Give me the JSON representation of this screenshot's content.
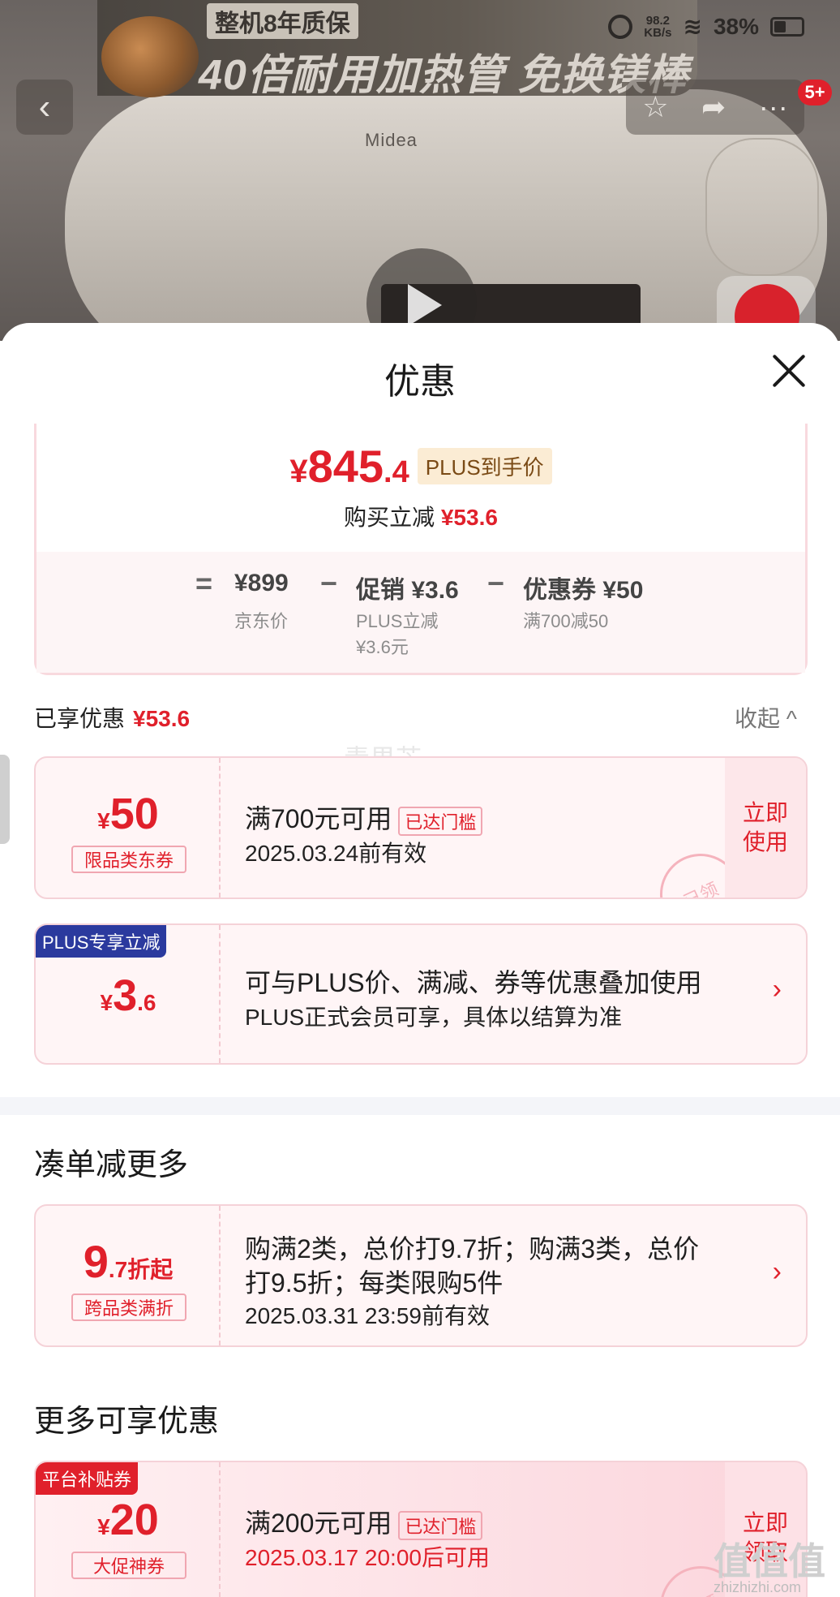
{
  "status_bar": {
    "speed_value": "98.2",
    "speed_unit": "KB/s",
    "battery": "38%"
  },
  "hero": {
    "banner_top": "整机8年质保",
    "banner_main": "40倍耐用加热管 免换镁棒",
    "brand": "Midea"
  },
  "nav": {
    "back_icon": "‹",
    "star_icon": "☆",
    "share_icon": "➦",
    "more_icon": "···",
    "badge": "5+"
  },
  "sheet": {
    "title": "优惠",
    "price": {
      "yen": "¥",
      "integer": "845",
      "decimal": ".4",
      "tag": "PLUS到手价"
    },
    "reduction": {
      "label": "购买立减",
      "value": "¥53.6"
    },
    "breakdown": {
      "equals": "=",
      "jd_price": "¥899",
      "jd_label": "京东价",
      "minus1": "−",
      "promo": "促销 ¥3.6",
      "promo_sub1": "PLUS立减",
      "promo_sub2": "¥3.6元",
      "minus2": "−",
      "coupon": "优惠券 ¥50",
      "coupon_sub": "满700减50"
    },
    "enjoyed": {
      "label": "已享优惠",
      "value": "¥53.6",
      "collapse": "收起",
      "collapse_icon": "^"
    },
    "watermark": "青果芒"
  },
  "cards": [
    {
      "yen": "¥",
      "amount": "50",
      "pill": "限品类东券",
      "title": "满700元可用",
      "threshold": "已达门槛",
      "date": "2025.03.24前有效",
      "action_line1": "立即",
      "action_line2": "使用",
      "stamp": "已领"
    },
    {
      "corner": "PLUS专享立减",
      "yen": "¥",
      "amount": "3",
      "amount_dec": ".6",
      "title": "可与PLUS价、满减、券等优惠叠加使用",
      "sub": "PLUS正式会员可享，具体以结算为准",
      "chevron": "›"
    }
  ],
  "section_more_orders": {
    "heading": "凑单减更多",
    "card": {
      "amount": "9",
      "amount_suffix": ".7折起",
      "pill": "跨品类满折",
      "line1": "购满2类，总价打9.7折；购满3类，总价",
      "line2": "打9.5折；每类限购5件",
      "date": "2025.03.31 23:59前有效",
      "chevron": "›"
    }
  },
  "section_more_offers": {
    "heading": "更多可享优惠",
    "card": {
      "corner": "平台补贴券",
      "yen": "¥",
      "amount": "20",
      "pill": "大促神券",
      "title": "满200元可用",
      "threshold": "已达门槛",
      "date": "2025.03.17 20:00后可用",
      "action_line1": "立即",
      "action_line2": "领取",
      "stamp": "已领"
    }
  },
  "site_watermark": {
    "name": "值值值",
    "url": "zhizhizhi.com"
  },
  "colors": {
    "accent_red": "#e0202b",
    "plus_blue": "#2b3a9e",
    "coupon_bg": "#fff5f6"
  }
}
